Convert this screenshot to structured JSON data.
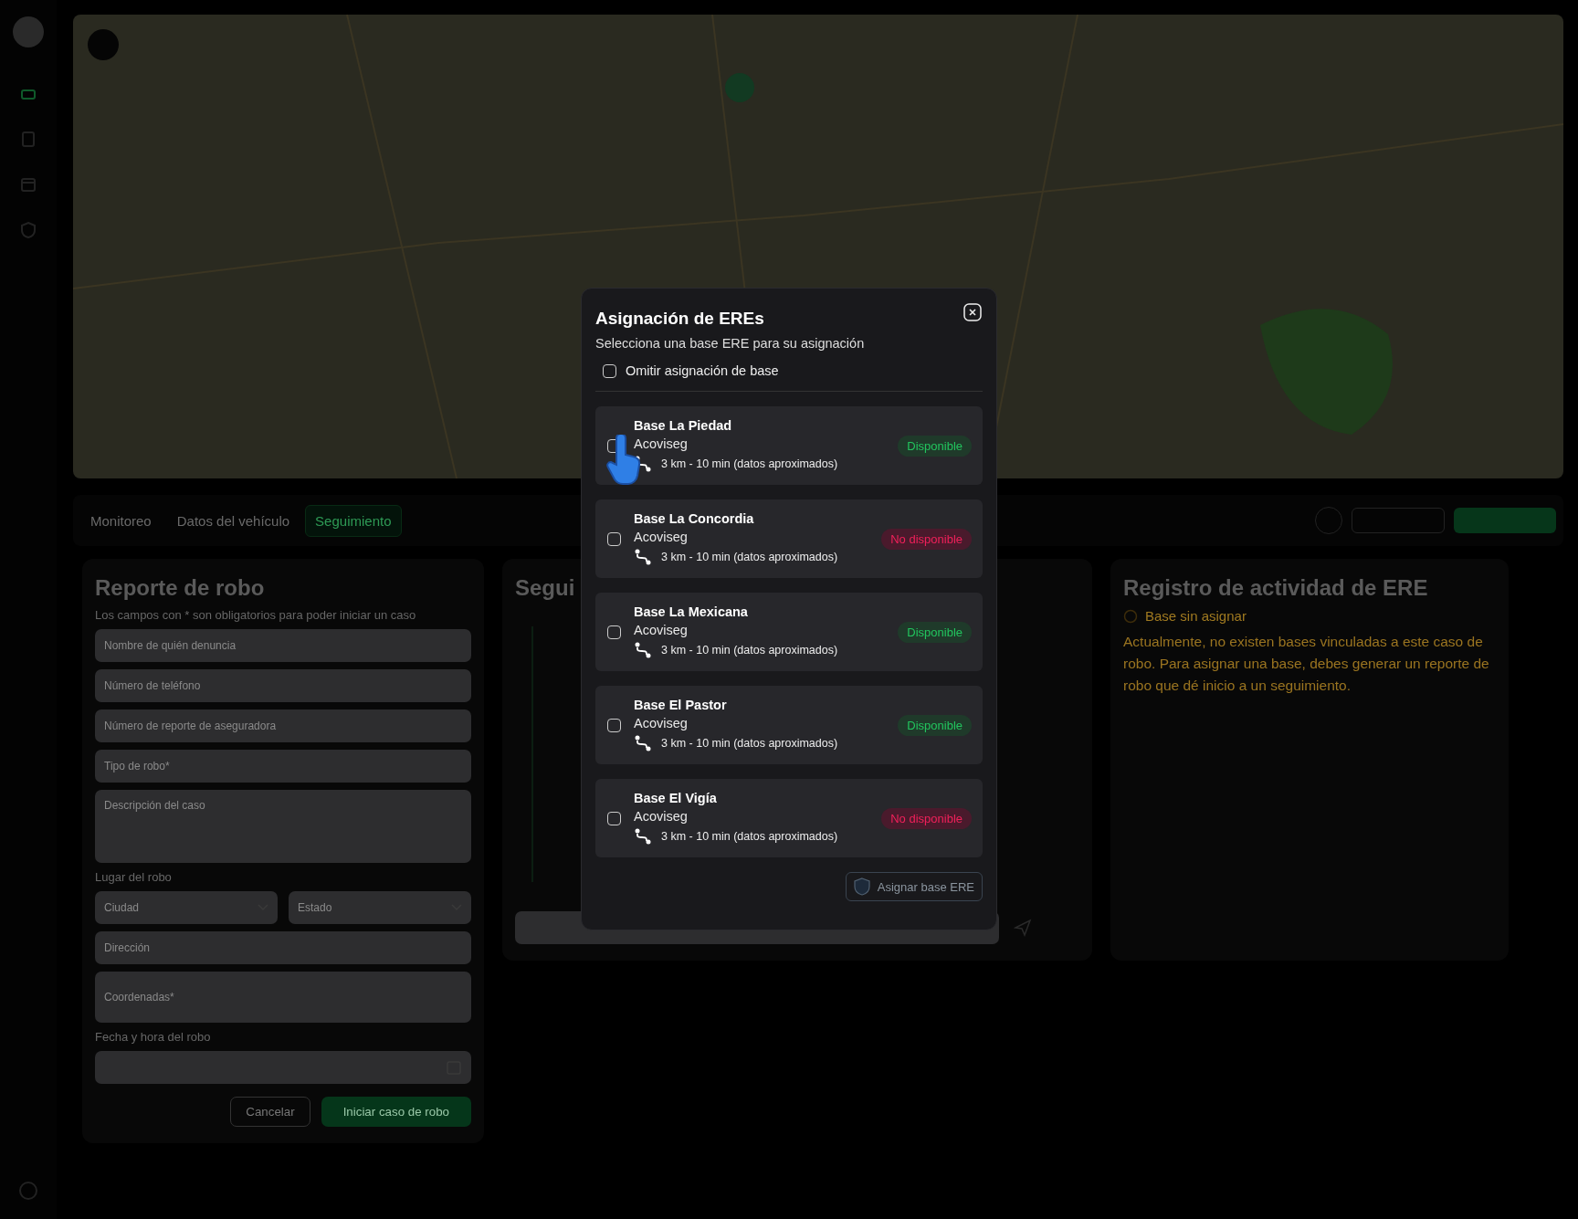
{
  "sidebar": {
    "items": [
      {
        "kind": "car",
        "selected": true
      },
      {
        "kind": "doc",
        "selected": false
      },
      {
        "kind": "calendar",
        "selected": false
      },
      {
        "kind": "shield",
        "selected": false
      }
    ]
  },
  "tabs": [
    {
      "label": "Monitoreo",
      "selected": false
    },
    {
      "label": "Datos del vehículo",
      "selected": false
    },
    {
      "label": "Seguimiento",
      "selected": true
    }
  ],
  "theft_report": {
    "title": "Reporte de robo",
    "subtitle": "Los campos con * son obligatorios para poder iniciar un caso",
    "fields": [
      {
        "kind": "input",
        "placeholder": "Nombre de quién denuncia"
      },
      {
        "kind": "input",
        "placeholder": "Número de teléfono"
      },
      {
        "kind": "input",
        "placeholder": "Número de reporte de aseguradora"
      },
      {
        "kind": "input",
        "placeholder": "Tipo de robo*"
      },
      {
        "kind": "textarea",
        "placeholder": "Descripción del caso"
      }
    ],
    "location_label": "Lugar del robo",
    "city": {
      "placeholder": "Ciudad"
    },
    "state": {
      "placeholder": "Estado"
    },
    "address": {
      "placeholder": "Dirección"
    },
    "coordinates": {
      "placeholder": "Coordenadas*"
    },
    "date_label": "Fecha y hora del robo",
    "buttons": [
      {
        "kind": "secondary",
        "label": "Cancelar"
      },
      {
        "kind": "primary",
        "label": "Iniciar caso de robo"
      }
    ]
  },
  "tracking": {
    "title": "Segui"
  },
  "activity": {
    "title": "Registro de actividad de ERE",
    "status": "Base sin asignar",
    "message": "Actualmente, no existen bases vinculadas a este caso de robo. Para asignar una base, debes generar un reporte de robo que dé inicio a un seguimiento."
  },
  "modal": {
    "title": "Asignación de EREs",
    "subtitle": "Selecciona una base ERE para su asignación",
    "skip": {
      "label": "Omitir asignación de base",
      "checked": false
    },
    "bases": [
      {
        "name": "Base La Piedad",
        "company": "Acoviseg",
        "distance": "3 km - 10 min (datos aproximados)",
        "status": "Disponible",
        "available": true,
        "selected": false
      },
      {
        "name": "Base La Concordia",
        "company": "Acoviseg",
        "distance": "3 km - 10 min (datos aproximados)",
        "status": "No disponible",
        "available": false,
        "selected": false
      },
      {
        "name": "Base La Mexicana",
        "company": "Acoviseg",
        "distance": "3 km - 10 min (datos aproximados)",
        "status": "Disponible",
        "available": true,
        "selected": false
      },
      {
        "name": "Base El Pastor",
        "company": "Acoviseg",
        "distance": "3 km - 10 min (datos aproximados)",
        "status": "Disponible",
        "available": true,
        "selected": false
      },
      {
        "name": "Base El Vigía",
        "company": "Acoviseg",
        "distance": "3 km - 10 min (datos aproximados)",
        "status": "No disponible",
        "available": false,
        "selected": false
      }
    ],
    "assign_button": {
      "label": "Asignar base ERE",
      "disabled": true
    }
  }
}
